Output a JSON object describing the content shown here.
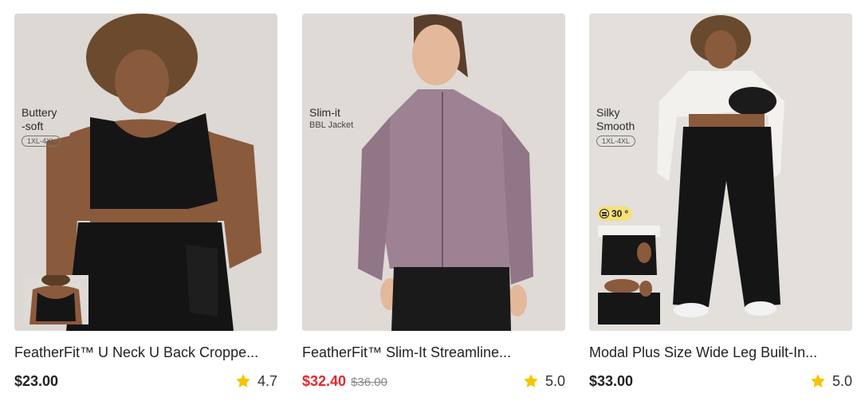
{
  "products": [
    {
      "overlay": {
        "line1": "Buttery",
        "line2": "-soft",
        "size_tag": "1XL-4XL"
      },
      "title": "FeatherFit™ U Neck U Back Croppe...",
      "price": "$23.00",
      "rating": "4.7",
      "icon": "star-icon"
    },
    {
      "overlay": {
        "line1": "Slim-it",
        "subtitle": "BBL Jacket"
      },
      "title": "FeatherFit™ Slim-It Streamline...",
      "price": "$32.40",
      "original_price": "$36.00",
      "rating": "5.0",
      "icon": "star-icon"
    },
    {
      "overlay": {
        "line1": "Silky",
        "line2": "Smooth",
        "size_tag": "1XL-4XL"
      },
      "badge": "30",
      "title": "Modal Plus Size Wide Leg Built-In...",
      "price": "$33.00",
      "rating": "5.0",
      "icon": "star-icon"
    }
  ],
  "colors": {
    "sale_price": "#e4282e",
    "star": "#f6c400",
    "badge": "#f5e07a",
    "photo_background": "#d9d6d2"
  }
}
